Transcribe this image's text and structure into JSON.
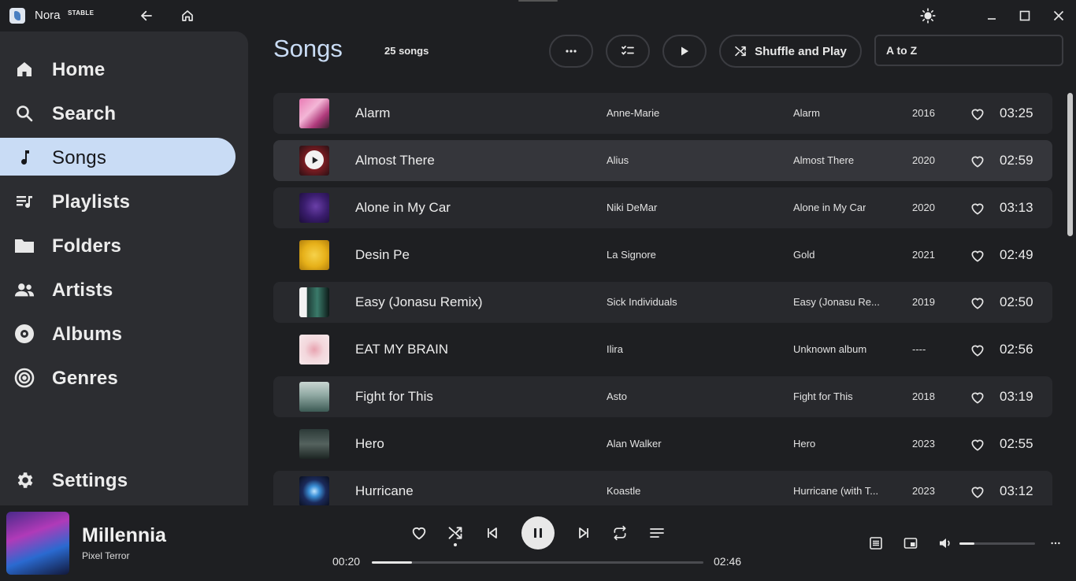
{
  "app": {
    "name": "Nora",
    "badge": "STABLE"
  },
  "sidebar": {
    "items": [
      {
        "label": "Home",
        "icon": "home-icon",
        "active": false
      },
      {
        "label": "Search",
        "icon": "search-icon",
        "active": false
      },
      {
        "label": "Songs",
        "icon": "music-note-icon",
        "active": true
      },
      {
        "label": "Playlists",
        "icon": "playlist-icon",
        "active": false
      },
      {
        "label": "Folders",
        "icon": "folder-icon",
        "active": false
      },
      {
        "label": "Artists",
        "icon": "people-icon",
        "active": false
      },
      {
        "label": "Albums",
        "icon": "disc-icon",
        "active": false
      },
      {
        "label": "Genres",
        "icon": "genres-icon",
        "active": false
      }
    ],
    "settings_label": "Settings"
  },
  "header": {
    "title": "Songs",
    "count": "25 songs",
    "shuffle_label": "Shuffle and Play",
    "sort_value": "A to Z"
  },
  "songs": [
    {
      "title": "Alarm",
      "artist": "Anne-Marie",
      "album": "Alarm",
      "year": "2016",
      "duration": "03:25"
    },
    {
      "title": "Almost There",
      "artist": "Alius",
      "album": "Almost There",
      "year": "2020",
      "duration": "02:59"
    },
    {
      "title": "Alone in My Car",
      "artist": "Niki DeMar",
      "album": "Alone in My Car",
      "year": "2020",
      "duration": "03:13"
    },
    {
      "title": "Desin Pe",
      "artist": "La Signore",
      "album": "Gold",
      "year": "2021",
      "duration": "02:49"
    },
    {
      "title": "Easy (Jonasu Remix)",
      "artist": "Sick Individuals",
      "album": "Easy (Jonasu Re...",
      "year": "2019",
      "duration": "02:50"
    },
    {
      "title": "EAT MY BRAIN",
      "artist": "Ilira",
      "album": "Unknown album",
      "year": "----",
      "duration": "02:56"
    },
    {
      "title": "Fight for This",
      "artist": "Asto",
      "album": "Fight for This",
      "year": "2018",
      "duration": "03:19"
    },
    {
      "title": "Hero",
      "artist": "Alan Walker",
      "album": "Hero",
      "year": "2023",
      "duration": "02:55"
    },
    {
      "title": "Hurricane",
      "artist": "Koastle",
      "album": "Hurricane (with T...",
      "year": "2023",
      "duration": "03:12"
    }
  ],
  "player": {
    "title": "Millennia",
    "artist": "Pixel Terror",
    "current_time": "00:20",
    "total_time": "02:46",
    "progress_fraction": 0.12,
    "volume_fraction": 0.2
  },
  "colors": {
    "accent": "#c9dcf5",
    "background": "#1e1f22",
    "sidebar": "#2c2d31"
  }
}
